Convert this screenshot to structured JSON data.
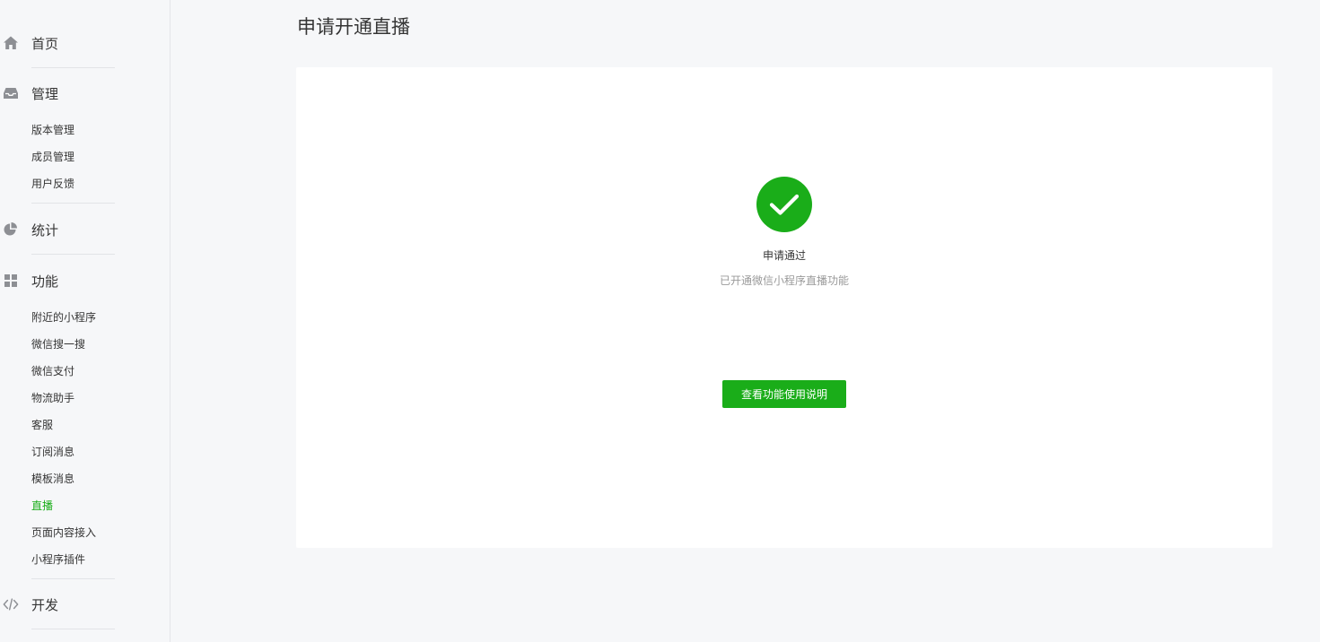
{
  "sidebar": {
    "groups": [
      {
        "title": "首页",
        "icon": "home-icon",
        "items": []
      },
      {
        "title": "管理",
        "icon": "inbox-icon",
        "items": [
          "版本管理",
          "成员管理",
          "用户反馈"
        ]
      },
      {
        "title": "统计",
        "icon": "pie-chart-icon",
        "items": []
      },
      {
        "title": "功能",
        "icon": "grid-icon",
        "items": [
          "附近的小程序",
          "微信搜一搜",
          "微信支付",
          "物流助手",
          "客服",
          "订阅消息",
          "模板消息",
          "直播",
          "页面内容接入",
          "小程序插件"
        ]
      },
      {
        "title": "开发",
        "icon": "code-icon",
        "items": []
      }
    ],
    "active_item": "直播"
  },
  "main": {
    "page_title": "申请开通直播",
    "result": {
      "status_icon": "check-circle-icon",
      "title": "申请通过",
      "description": "已开通微信小程序直播功能",
      "button_label": "查看功能使用说明"
    }
  },
  "colors": {
    "accent": "#1aad19",
    "text": "#353535",
    "muted": "#9a9a9a",
    "background": "#f6f7f9",
    "card": "#ffffff",
    "icon": "#8d8f94"
  }
}
